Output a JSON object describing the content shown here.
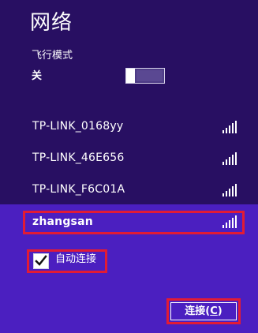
{
  "panel": {
    "title": "网络"
  },
  "airplane_mode": {
    "label": "飞行模式",
    "state": "关"
  },
  "networks": [
    {
      "name": "TP-LINK_0168yy",
      "signal": 5
    },
    {
      "name": "TP-LINK_46E656",
      "signal": 5
    },
    {
      "name": "TP-LINK_F6C01A",
      "signal": 5
    },
    {
      "name": "zhangsan",
      "signal": 5,
      "selected": true
    }
  ],
  "auto_connect": {
    "label": "自动连接",
    "checked": true
  },
  "connect_button": {
    "prefix": "连接(",
    "mnemonic": "C",
    "suffix": ")"
  },
  "colors": {
    "panel_background": "#280f62",
    "selected_background": "#4b1fc0",
    "highlight_border": "#e21b35",
    "text": "#ffffff"
  }
}
